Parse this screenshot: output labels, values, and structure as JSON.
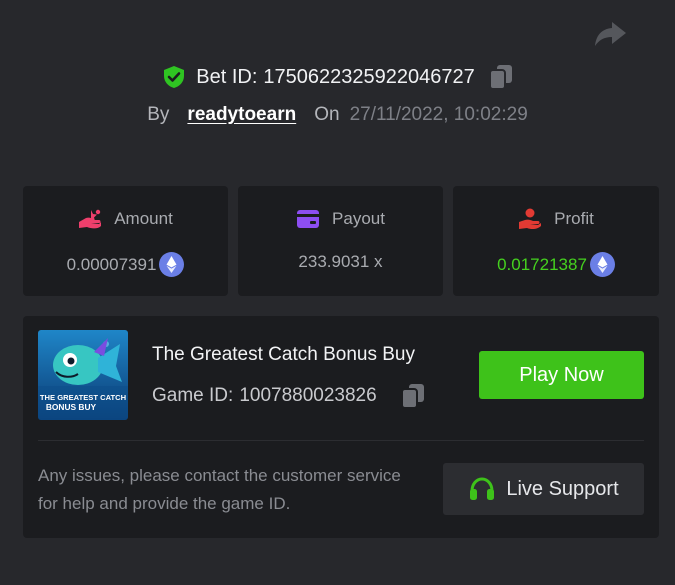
{
  "bet": {
    "label": "Bet ID:",
    "id": "1750622325922046727",
    "by_label": "By",
    "username": "readytoearn",
    "on_label": "On",
    "datetime": "27/11/2022, 10:02:29"
  },
  "stats": {
    "amount": {
      "label": "Amount",
      "value": "0.00007391",
      "icon": "bet-hand-icon",
      "currency_icon": "eth-icon"
    },
    "payout": {
      "label": "Payout",
      "value": "233.9031 x",
      "icon": "wallet-card-icon"
    },
    "profit": {
      "label": "Profit",
      "value": "0.01721387",
      "icon": "profit-hand-icon",
      "currency_icon": "eth-icon"
    }
  },
  "game": {
    "title": "The Greatest Catch Bonus Buy",
    "id_label": "Game ID:",
    "id": "1007880023826",
    "thumb_line1": "THE GREATEST CATCH",
    "thumb_line2": "BONUS BUY",
    "play_label": "Play Now"
  },
  "support": {
    "help_text": "Any issues, please contact the customer service for help and provide the game ID.",
    "button_label": "Live Support"
  },
  "colors": {
    "background": "#27282c",
    "card": "#1b1c1f",
    "accent_green": "#3ec21a",
    "profit_green": "#45d11f",
    "amount_icon": "#ee3f6c",
    "payout_icon": "#8d4ef2",
    "profit_icon": "#e23a33",
    "eth": "#6b7fe6"
  }
}
